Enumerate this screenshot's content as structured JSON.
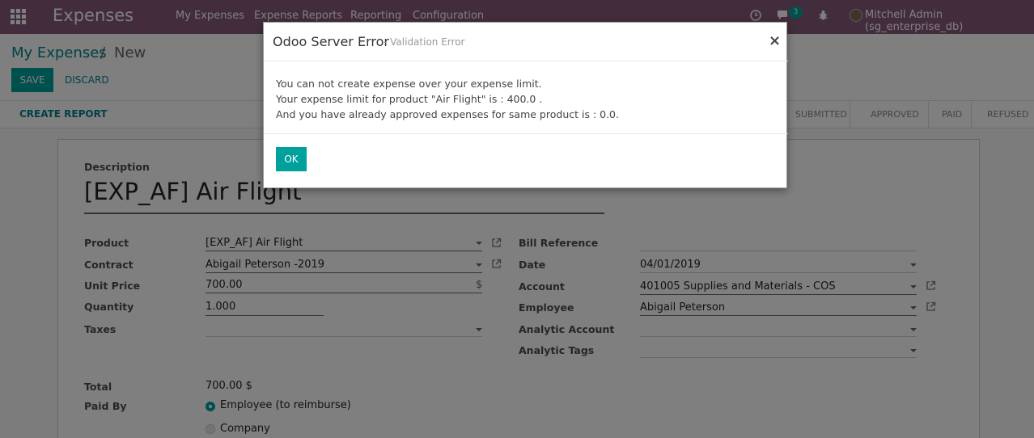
{
  "navbar": {
    "app_title": "Expenses",
    "menu": [
      "My Expenses",
      "Expense Reports",
      "Reporting",
      "Configuration"
    ],
    "messages_count": "3",
    "user": "Mitchell Admin (sg_enterprise_db)"
  },
  "breadcrumb": {
    "parent": "My Expenses",
    "separator": "/",
    "current": "New"
  },
  "buttons": {
    "save": "SAVE",
    "discard": "DISCARD"
  },
  "statusbar": {
    "create_report": "CREATE REPORT",
    "stages": [
      "SUBMITTED",
      "APPROVED",
      "PAID",
      "REFUSED"
    ]
  },
  "form": {
    "description_label": "Description",
    "description_value": "[EXP_AF] Air Flight",
    "left_labels": {
      "product": "Product",
      "contract": "Contract",
      "unit_price": "Unit Price",
      "quantity": "Quantity",
      "taxes": "Taxes",
      "total": "Total",
      "paid_by": "Paid By"
    },
    "left_values": {
      "product": "[EXP_AF] Air Flight",
      "contract": "Abigail Peterson -2019",
      "unit_price": "700.00",
      "currency_symbol": "$",
      "quantity": "1.000",
      "taxes": "",
      "total": "700.00 $"
    },
    "paid_by_options": [
      "Employee (to reimburse)",
      "Company"
    ],
    "paid_by_selected": 0,
    "right_labels": {
      "bill_reference": "Bill Reference",
      "date": "Date",
      "account": "Account",
      "employee": "Employee",
      "analytic_account": "Analytic Account",
      "analytic_tags": "Analytic Tags"
    },
    "right_values": {
      "bill_reference": "",
      "date": "04/01/2019",
      "account": "401005 Supplies and Materials - COS",
      "employee": "Abigail Peterson",
      "analytic_account": "",
      "analytic_tags": ""
    }
  },
  "modal": {
    "title": "Odoo Server Error",
    "subtitle": "- Validation Error",
    "close": "×",
    "message_lines": [
      "You can not create expense over your expense limit.",
      "Your expense limit for product \"Air Flight\" is : 400.0 .",
      "And you have already approved expenses for same product is : 0.0."
    ],
    "ok": "OK"
  },
  "colors": {
    "navbar": "#875a7b",
    "primary": "#00a09d",
    "link": "#00838f"
  }
}
